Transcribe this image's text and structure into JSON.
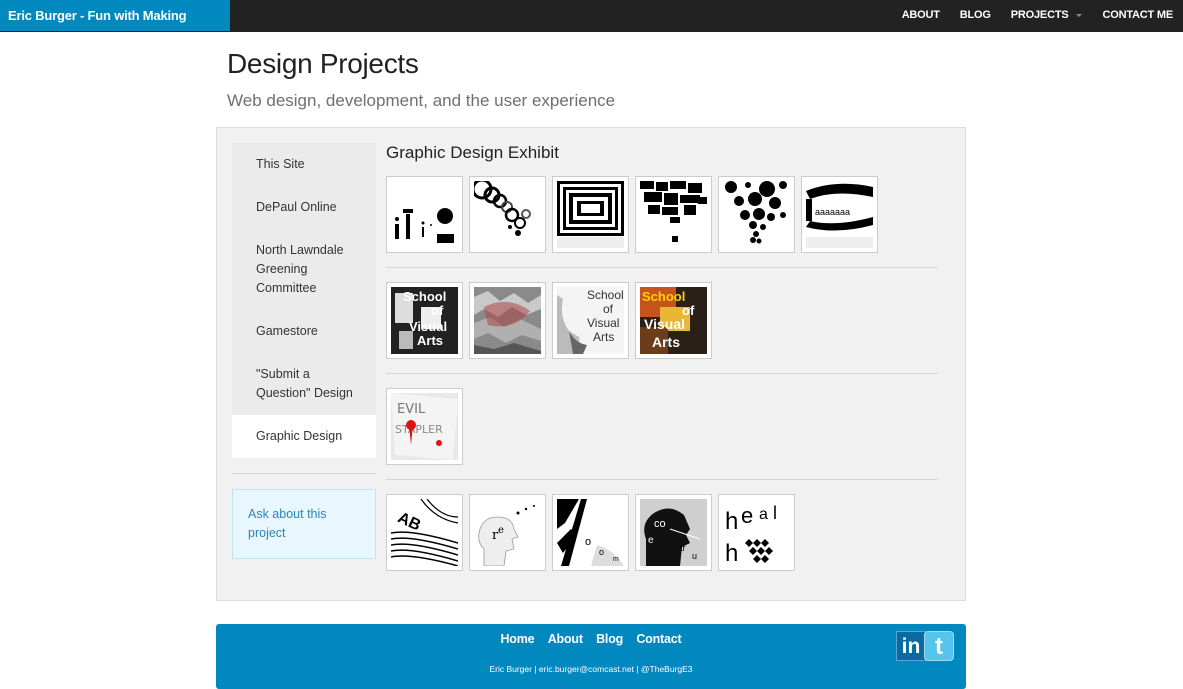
{
  "nav": {
    "brand": "Eric Burger - Fun with Making Things",
    "links": [
      {
        "label": "ABOUT"
      },
      {
        "label": "BLOG"
      },
      {
        "label": "PROJECTS"
      },
      {
        "label": "CONTACT ME"
      }
    ]
  },
  "header": {
    "title": "Design Projects",
    "subtitle": "Web design, development, and the user experience"
  },
  "sidebar": {
    "items": [
      {
        "label": "This Site"
      },
      {
        "label": "DePaul Online"
      },
      {
        "label": "North Lawndale Greening Committee"
      },
      {
        "label": "Gamestore"
      },
      {
        "label": "\"Submit a Question\" Design"
      },
      {
        "label": "Graphic Design"
      }
    ],
    "active_index": 5,
    "ask_label": "Ask about this project"
  },
  "main": {
    "title": "Graphic Design Exhibit",
    "rows": [
      {
        "thumbs": [
          "typography-dots",
          "circles-chain",
          "nested-squares",
          "scattered-blocks",
          "dot-cluster",
          "wave-letters"
        ]
      },
      {
        "thumbs": [
          "school-visual-arts-bw",
          "crumpled-paper",
          "school-visual-arts-sketch",
          "school-visual-arts-color"
        ]
      },
      {
        "thumbs": [
          "evil-stapler"
        ]
      },
      {
        "thumbs": [
          "type-lines",
          "head-profile-letters",
          "slash-letters",
          "deconstruct-head",
          "heal-letters"
        ]
      }
    ]
  },
  "footer": {
    "links": [
      {
        "label": "Home"
      },
      {
        "label": "About"
      },
      {
        "label": "Blog"
      },
      {
        "label": "Contact"
      }
    ],
    "info": "Eric Burger | eric.burger@comcast.net | @TheBurgE3",
    "linkedin_label": "in",
    "twitter_label": "t"
  },
  "colors": {
    "brand": "#0088bf",
    "navbar": "#222222",
    "panel": "#f1f1f1",
    "ask_box": "#e8f6fd"
  }
}
